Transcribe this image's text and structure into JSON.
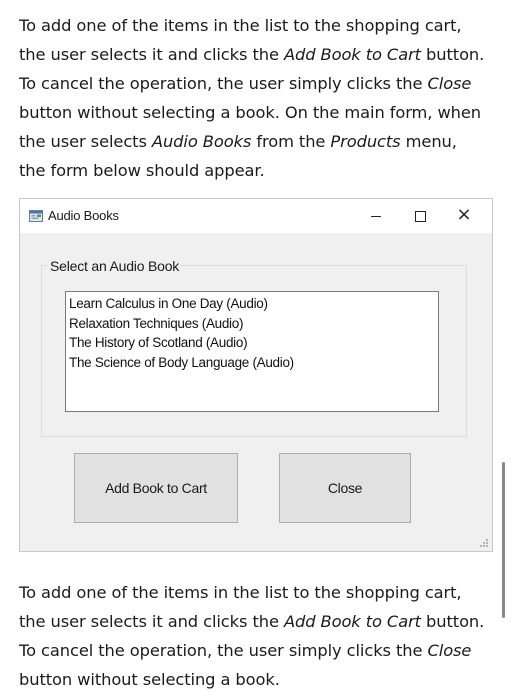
{
  "intro_paragraph": {
    "l1": "To add one of the items in the list to the shopping cart,",
    "l2a": "the user selects it and clicks the ",
    "l2b": "Add Book to Cart",
    "l2c": " button.",
    "l3a": "To cancel the operation, the user simply clicks the ",
    "l3b": "Close",
    "l4": "button without selecting a book. On the main form, when",
    "l5a": "the user selects ",
    "l5b": "Audio Books",
    "l5c": " from the ",
    "l5d": "Products",
    "l5e": " menu,",
    "l6": "the form below should appear."
  },
  "window": {
    "title": "Audio Books",
    "icon": "form-app-icon",
    "controls": {
      "minimize": "minimize-icon",
      "maximize": "maximize-icon",
      "close": "×"
    },
    "group_label": "Select an Audio Book",
    "list_items": [
      "Learn Calculus in One Day (Audio)",
      "Relaxation Techniques (Audio)",
      "The History of Scotland (Audio)",
      "The Science of Body Language (Audio)"
    ],
    "add_button_label": "Add Book to Cart",
    "close_button_label": "Close"
  },
  "outro_paragraph": {
    "l1": "To add one of the items in the list to the shopping cart,",
    "l2a": "the user selects it and clicks the ",
    "l2b": "Add Book to Cart",
    "l2c": " button.",
    "l3a": "To cancel the operation, the user simply clicks the ",
    "l3b": "Close",
    "l4": "button without selecting a book."
  },
  "colors": {
    "window_bg": "#f0f0f0",
    "button_bg": "#e1e1e1",
    "titlebar_bg": "#ffffff"
  }
}
